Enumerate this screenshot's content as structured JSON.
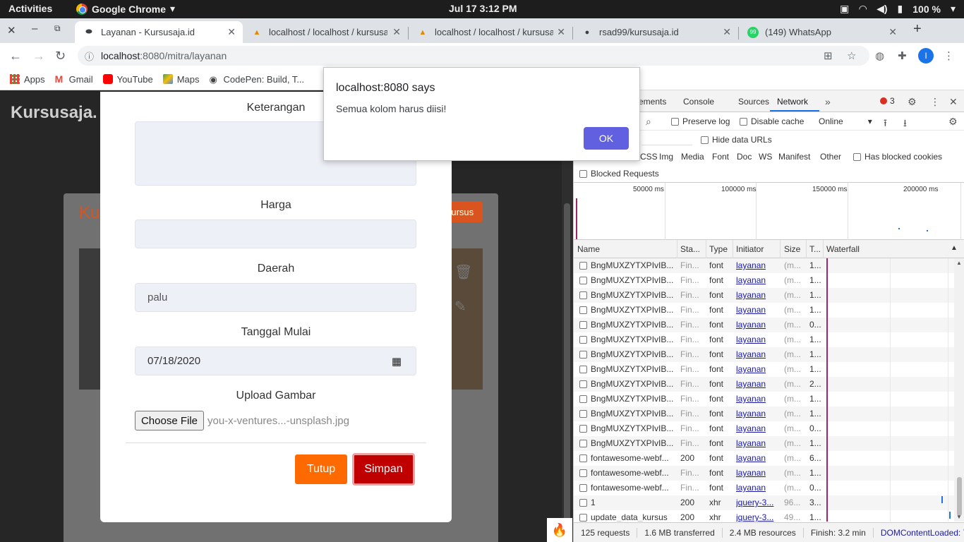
{
  "gnome": {
    "activities": "Activities",
    "app_name": "Google Chrome",
    "clock": "Jul 17   3:12 PM",
    "battery": "100 %"
  },
  "tabs": [
    {
      "title": "Layanan - Kursusaja.id",
      "icon": "kursusaja-favicon"
    },
    {
      "title": "localhost / localhost / kursusaj",
      "icon": "phpmyadmin-icon"
    },
    {
      "title": "localhost / localhost / kursusaj",
      "icon": "phpmyadmin-icon"
    },
    {
      "title": "rsad99/kursusaja.id",
      "icon": "github-icon"
    },
    {
      "title": "(149) WhatsApp",
      "icon": "whatsapp-icon"
    }
  ],
  "toolbar": {
    "url_host": "localhost",
    "url_path": ":8080/mitra/layanan",
    "profile_initial": "I"
  },
  "bookmarks": [
    {
      "label": "Apps",
      "icon": "apps-grid-icon"
    },
    {
      "label": "Gmail",
      "icon": "gmail-icon"
    },
    {
      "label": "YouTube",
      "icon": "youtube-icon"
    },
    {
      "label": "Maps",
      "icon": "maps-icon"
    },
    {
      "label": "CodePen: Build, T...",
      "icon": "codepen-icon"
    }
  ],
  "page": {
    "logo": "Kursusaja.",
    "bg_title": "Ku",
    "bg_button": "kursus"
  },
  "modal": {
    "keterangan_label": "Keterangan",
    "keterangan_value": "",
    "harga_label": "Harga",
    "harga_value": "",
    "daerah_label": "Daerah",
    "daerah_value": "palu",
    "tanggal_label": "Tanggal Mulai",
    "tanggal_value": "07/18/2020",
    "upload_label": "Upload Gambar",
    "choose_file": "Choose File",
    "file_name": "you-x-ventures...-unsplash.jpg",
    "tutup": "Tutup",
    "simpan": "Simpan"
  },
  "alert": {
    "title": "localhost:8080 says",
    "message": "Semua kolom harus diisi!",
    "ok": "OK"
  },
  "devtools": {
    "tabs": [
      "ements",
      "Console",
      "Sources",
      "Network"
    ],
    "active_tab": "Network",
    "error_count": "3",
    "preserve_log": "Preserve log",
    "disable_cache": "Disable cache",
    "throttle": "Online",
    "hide_data_urls": "Hide data URLs",
    "filters": [
      "CSS",
      "Img",
      "Media",
      "Font",
      "Doc",
      "WS",
      "Manifest",
      "Other"
    ],
    "has_blocked_cookies": "Has blocked cookies",
    "blocked_requests": "Blocked Requests",
    "overview_labels": [
      "50000 ms",
      "100000 ms",
      "150000 ms",
      "200000 ms"
    ],
    "columns": [
      "Name",
      "Sta...",
      "Type",
      "Initiator",
      "Size",
      "T...",
      "Waterfall"
    ],
    "rows": [
      {
        "name": "BngMUXZYTXPIvIB...",
        "status": "Fin...",
        "type": "font",
        "initiator": "layanan",
        "size": "(m...",
        "time": "1..."
      },
      {
        "name": "BngMUXZYTXPIvIB...",
        "status": "Fin...",
        "type": "font",
        "initiator": "layanan",
        "size": "(m...",
        "time": "1..."
      },
      {
        "name": "BngMUXZYTXPIvIB...",
        "status": "Fin...",
        "type": "font",
        "initiator": "layanan",
        "size": "(m...",
        "time": "1..."
      },
      {
        "name": "BngMUXZYTXPIvIB...",
        "status": "Fin...",
        "type": "font",
        "initiator": "layanan",
        "size": "(m...",
        "time": "1..."
      },
      {
        "name": "BngMUXZYTXPIvIB...",
        "status": "Fin...",
        "type": "font",
        "initiator": "layanan",
        "size": "(m...",
        "time": "0..."
      },
      {
        "name": "BngMUXZYTXPIvIB...",
        "status": "Fin...",
        "type": "font",
        "initiator": "layanan",
        "size": "(m...",
        "time": "1..."
      },
      {
        "name": "BngMUXZYTXPIvIB...",
        "status": "Fin...",
        "type": "font",
        "initiator": "layanan",
        "size": "(m...",
        "time": "1..."
      },
      {
        "name": "BngMUXZYTXPIvIB...",
        "status": "Fin...",
        "type": "font",
        "initiator": "layanan",
        "size": "(m...",
        "time": "1..."
      },
      {
        "name": "BngMUXZYTXPIvIB...",
        "status": "Fin...",
        "type": "font",
        "initiator": "layanan",
        "size": "(m...",
        "time": "2..."
      },
      {
        "name": "BngMUXZYTXPIvIB...",
        "status": "Fin...",
        "type": "font",
        "initiator": "layanan",
        "size": "(m...",
        "time": "1..."
      },
      {
        "name": "BngMUXZYTXPIvIB...",
        "status": "Fin...",
        "type": "font",
        "initiator": "layanan",
        "size": "(m...",
        "time": "1..."
      },
      {
        "name": "BngMUXZYTXPIvIB...",
        "status": "Fin...",
        "type": "font",
        "initiator": "layanan",
        "size": "(m...",
        "time": "0..."
      },
      {
        "name": "BngMUXZYTXPIvIB...",
        "status": "Fin...",
        "type": "font",
        "initiator": "layanan",
        "size": "(m...",
        "time": "1..."
      },
      {
        "name": "fontawesome-webf...",
        "status": "200",
        "type": "font",
        "initiator": "layanan",
        "size": "(m...",
        "time": "6..."
      },
      {
        "name": "fontawesome-webf...",
        "status": "Fin...",
        "type": "font",
        "initiator": "layanan",
        "size": "(m...",
        "time": "1..."
      },
      {
        "name": "fontawesome-webf...",
        "status": "Fin...",
        "type": "font",
        "initiator": "layanan",
        "size": "(m...",
        "time": "0..."
      },
      {
        "name": "1",
        "status": "200",
        "type": "xhr",
        "initiator": "jquery-3...",
        "size": "96...",
        "time": "3..."
      },
      {
        "name": "update_data_kursus",
        "status": "200",
        "type": "xhr",
        "initiator": "jquery-3...",
        "size": "49...",
        "time": "1..."
      }
    ],
    "status_bar": {
      "requests": "125 requests",
      "transferred": "1.6 MB transferred",
      "resources": "2.4 MB resources",
      "finish": "Finish: 3.2 min",
      "dom_loaded": "DOMContentLoaded: 7"
    }
  }
}
